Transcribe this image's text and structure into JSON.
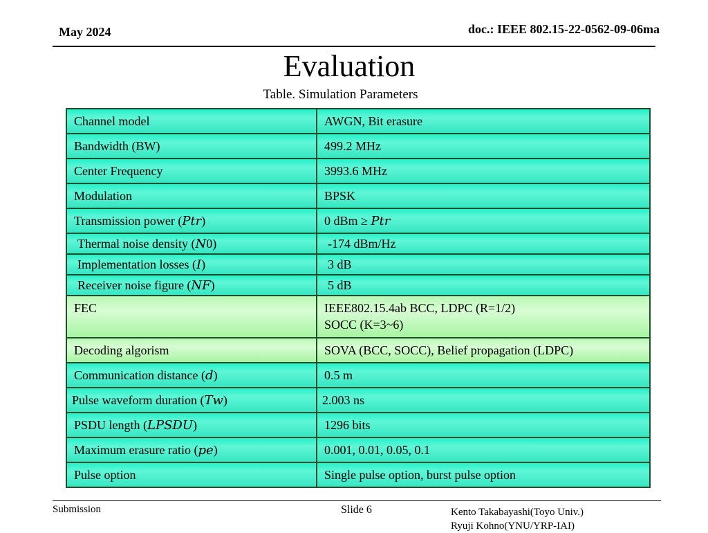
{
  "header": {
    "date": "May 2024",
    "doc_id": "doc.: IEEE 802.15-22-0562-09-06ma"
  },
  "title": "Evaluation",
  "table_caption": "Table. Simulation Parameters",
  "table": {
    "rows": [
      {
        "param": "Channel model",
        "value": "AWGN, Bit erasure"
      },
      {
        "param": "Bandwidth (BW)",
        "value": "499.2 MHz"
      },
      {
        "param": "Center Frequency",
        "value": "3993.6 MHz"
      },
      {
        "param": "Modulation",
        "value": "BPSK"
      },
      {
        "param": "Transmission power (𝑃𝑡𝑟)",
        "value": "0 dBm ≥ 𝑃𝑡𝑟"
      },
      {
        "param": "Thermal noise density (𝑁0)",
        "value": "-174 dBm/Hz"
      },
      {
        "param": "Implementation losses (𝐼)",
        "value": "3 dB"
      },
      {
        "param": "Receiver noise figure (𝑁𝐹)",
        "value": "5 dB"
      },
      {
        "param": "FEC",
        "value": "IEEE802.15.4ab BCC, LDPC (R=1/2)",
        "value_line2": "SOCC (K=3~6)"
      },
      {
        "param": "Decoding algorism",
        "value": "SOVA (BCC, SOCC), Belief propagation (LDPC)"
      },
      {
        "param": "Communication distance (𝑑)",
        "value": "0.5 m"
      },
      {
        "param": "Pulse waveform duration (𝑇𝑤)",
        "value": "2.003 ns"
      },
      {
        "param": "PSDU length (𝐿𝑃𝑆𝐷𝑈)",
        "value": "1296 bits"
      },
      {
        "param": "Maximum erasure ratio (𝑝𝑒)",
        "value": "0.001, 0.01, 0.05, 0.1"
      },
      {
        "param": "Pulse option",
        "value": "Single pulse option, burst pulse option"
      }
    ]
  },
  "footer": {
    "submission": "Submission",
    "slide": "Slide 6",
    "author1": "Kento Takabayashi(Toyo Univ.)",
    "author2": "Ryuji Kohno(YNU/YRP-IAI)"
  }
}
